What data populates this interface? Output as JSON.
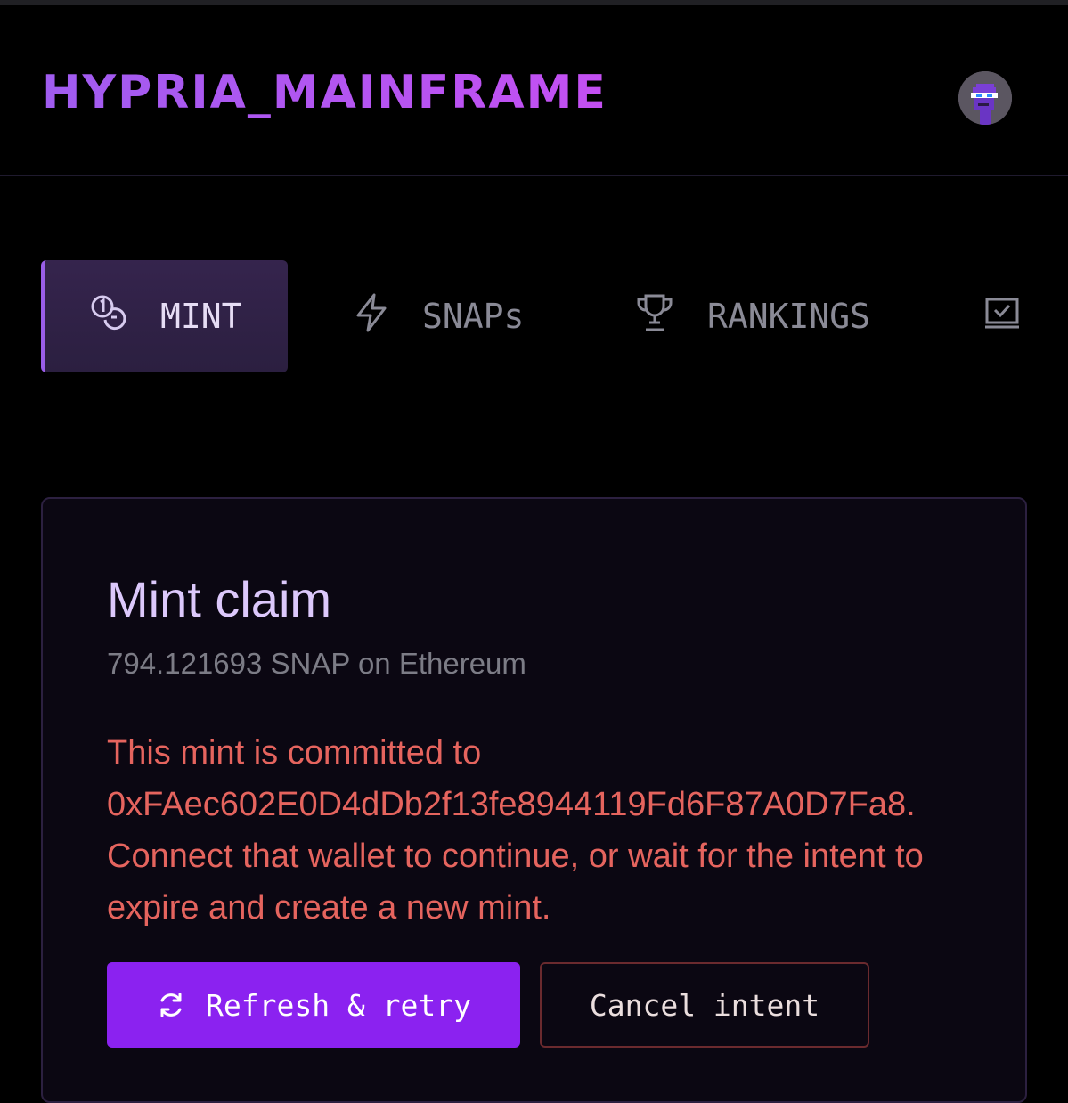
{
  "header": {
    "logo": "HYPRIA_MAINFRAME",
    "avatar_icon": "pixel-punk-avatar"
  },
  "tabs": [
    {
      "label": "MINT",
      "icon": "coins-icon",
      "active": true
    },
    {
      "label": "SNAPs",
      "icon": "lightning-icon",
      "active": false
    },
    {
      "label": "RANKINGS",
      "icon": "trophy-icon",
      "active": false
    },
    {
      "label": "",
      "icon": "checkbox-tray-icon",
      "active": false
    }
  ],
  "card": {
    "title": "Mint claim",
    "subtitle": "794.121693 SNAP on Ethereum",
    "message": "This mint is committed to 0xFAec602E0D4dDb2f13fe8944119Fd6F87A0D7Fa8. Connect that wallet to continue, or wait for the intent to expire and create a new mint.",
    "primary_button": "Refresh & retry",
    "primary_icon": "refresh-icon",
    "secondary_button": "Cancel intent"
  },
  "colors": {
    "accent": "#8b22f0",
    "logo": "#b25cf4",
    "error": "#e5645e",
    "title": "#dcc8fb"
  }
}
